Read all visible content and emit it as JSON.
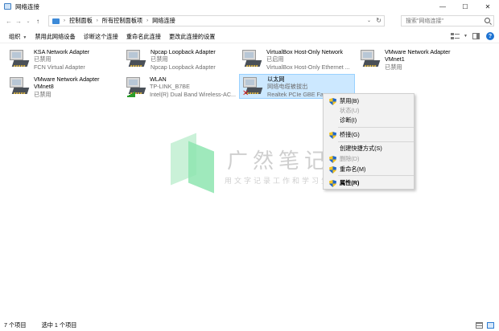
{
  "window": {
    "title": "网络连接",
    "minimize": "—",
    "maximize": "☐",
    "close": "✕"
  },
  "address": {
    "back": "←",
    "forward": "→",
    "dropdown": "⌄",
    "up": "↑",
    "crumbs": [
      "控制面板",
      "所有控制面板项",
      "网络连接"
    ],
    "crumb_sep": "›",
    "history": "⌄",
    "refresh": "↻"
  },
  "search": {
    "placeholder": "搜索\"网络连接\""
  },
  "toolbar": {
    "organize": "组织",
    "organize_caret": "▼",
    "disable_device": "禁用此网络设备",
    "diagnose": "诊断这个连接",
    "rename": "重命名此连接",
    "change_settings": "更改此连接的设置",
    "view_caret": "▼",
    "help": "?"
  },
  "adapters": [
    {
      "name": "KSA Network Adapter",
      "status": "已禁用",
      "device": "FCN Virtual Adapter",
      "icon": "network-adapter-icon"
    },
    {
      "name": "Npcap Loopback Adapter",
      "status": "已禁用",
      "device": "Npcap Loopback Adapter",
      "icon": "network-adapter-icon"
    },
    {
      "name": "VirtualBox Host-Only Network",
      "status": "已启用",
      "device": "VirtualBox Host-Only Ethernet ...",
      "icon": "network-adapter-icon"
    },
    {
      "name": "VMware Network Adapter VMnet1",
      "status": "已禁用",
      "device": "",
      "icon": "network-adapter-icon"
    },
    {
      "name": "VMware Network Adapter VMnet8",
      "status": "已禁用",
      "device": "",
      "icon": "network-adapter-icon"
    },
    {
      "name": "WLAN",
      "status": "TP-LINK_B7BE",
      "device": "Intel(R) Dual Band Wireless-AC...",
      "icon": "wireless-adapter-icon"
    },
    {
      "name": "以太网",
      "status": "网络电缆被拔出",
      "device": "Realtek PCIe GBE Fam",
      "icon": "ethernet-disconnected-icon"
    }
  ],
  "context_menu": {
    "items": [
      {
        "label": "禁用(B)",
        "shield": true,
        "disabled": false
      },
      {
        "label": "状态(U)",
        "shield": false,
        "disabled": true
      },
      {
        "label": "诊断(I)",
        "shield": false,
        "disabled": false
      },
      {
        "label": "桥接(G)",
        "shield": true,
        "disabled": false
      },
      {
        "label": "创建快捷方式(S)",
        "shield": false,
        "disabled": false
      },
      {
        "label": "删除(D)",
        "shield": true,
        "disabled": true
      },
      {
        "label": "重命名(M)",
        "shield": true,
        "disabled": false
      },
      {
        "label": "属性(R)",
        "shield": true,
        "disabled": false,
        "bold": true
      }
    ]
  },
  "watermark": {
    "title": "广然笔记",
    "subtitle": "用文字记录工作和学习生活"
  },
  "statusbar": {
    "count": "7 个项目",
    "selected": "选中 1 个项目"
  }
}
